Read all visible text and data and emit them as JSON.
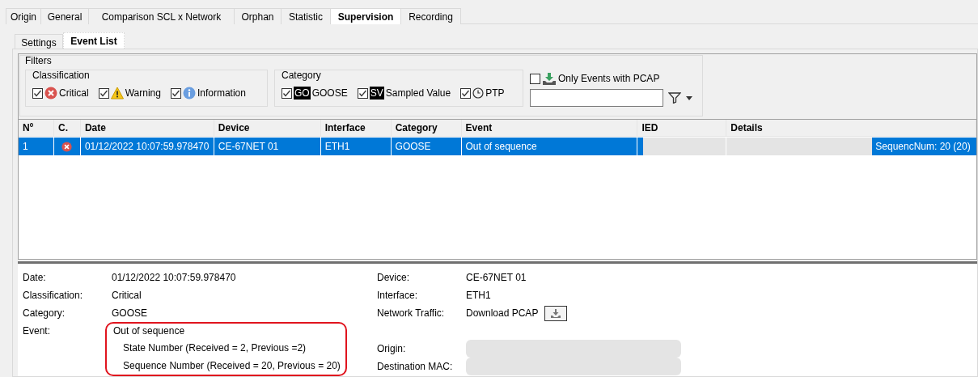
{
  "tabs": [
    {
      "label": "Origin",
      "selected": false
    },
    {
      "label": "General",
      "selected": false
    },
    {
      "label": "Comparison SCL x Network",
      "selected": false
    },
    {
      "label": "Orphan",
      "selected": false
    },
    {
      "label": "Statistic",
      "selected": false
    },
    {
      "label": "Supervision",
      "selected": true
    },
    {
      "label": "Recording",
      "selected": false
    }
  ],
  "subtabs": [
    {
      "label": "Settings",
      "selected": false
    },
    {
      "label": "Event List",
      "selected": true
    }
  ],
  "filters": {
    "title": "Filters",
    "classification": {
      "title": "Classification",
      "options": [
        {
          "kind": "critical",
          "label": "Critical",
          "checked": true
        },
        {
          "kind": "warning",
          "label": "Warning",
          "checked": true
        },
        {
          "kind": "information",
          "label": "Information",
          "checked": true
        }
      ]
    },
    "category": {
      "title": "Category",
      "options": [
        {
          "kind": "badge",
          "badge": "GO",
          "label": "GOOSE",
          "checked": true
        },
        {
          "kind": "badge",
          "badge": "SV",
          "label": "Sampled Value",
          "checked": true
        },
        {
          "kind": "clock",
          "label": "PTP",
          "checked": true
        }
      ]
    },
    "pcap": {
      "label": "Only Events with PCAP",
      "checked": false
    }
  },
  "table": {
    "columns": [
      "Nº",
      "C.",
      "Date",
      "Device",
      "Interface",
      "Category",
      "Event",
      "IED",
      "Details"
    ],
    "rows": [
      {
        "selected": true,
        "number": "1",
        "kind": "critical",
        "date": "01/12/2022 10:07:59.978470",
        "device": "CE-67NET 01",
        "interface": "ETH1",
        "category": "GOOSE",
        "event": "Out of sequence",
        "ied_redacted": true,
        "details": "SequencNum: 20 (20)"
      }
    ]
  },
  "detail": {
    "left": [
      {
        "label": "Date:",
        "value": "01/12/2022 10:07:59.978470"
      },
      {
        "label": "Classification:",
        "value": "Critical"
      },
      {
        "label": "Category:",
        "value": "GOOSE"
      },
      {
        "label": "Event:",
        "value": "Out of sequence",
        "lines": [
          "State Number (Received = 2, Previous =2)",
          "Sequence Number (Received = 20, Previous = 20)"
        ],
        "highlighted": true
      }
    ],
    "right": [
      {
        "kind": "text",
        "label": "Device:",
        "value": "CE-67NET 01"
      },
      {
        "kind": "text",
        "label": "Interface:",
        "value": "ETH1"
      },
      {
        "kind": "download",
        "label": "Network Traffic:",
        "value": "Download PCAP"
      },
      {
        "kind": "gap"
      },
      {
        "kind": "redacted",
        "label": "Origin:"
      },
      {
        "kind": "redacted",
        "label": "Destination MAC:"
      }
    ]
  }
}
